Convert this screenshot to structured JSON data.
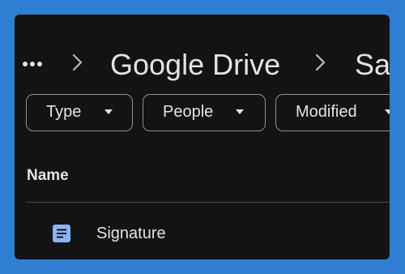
{
  "breadcrumb": {
    "more_icon": "more-horiz-icon",
    "separator_icon": "chevron-right-icon",
    "items": [
      {
        "label": "Google Drive"
      },
      {
        "label": "Sa"
      }
    ]
  },
  "filters": [
    {
      "label": "Type",
      "icon": "arrow-drop-down-icon"
    },
    {
      "label": "People",
      "icon": "arrow-drop-down-icon"
    },
    {
      "label": "Modified",
      "icon": "arrow-drop-down-icon"
    }
  ],
  "table": {
    "column_header": "Name"
  },
  "files": [
    {
      "name": "Signature",
      "icon": "google-docs-icon"
    }
  ],
  "colors": {
    "page_background": "#2e7fd3",
    "panel_background": "#131313",
    "text": "#e3e3e3",
    "doc_icon": "#8ab4f8"
  }
}
